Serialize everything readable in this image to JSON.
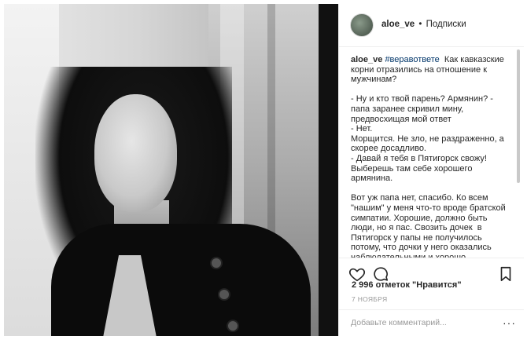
{
  "post": {
    "username": "aloe_ve",
    "separator": "•",
    "follow_label": "Подписки",
    "caption_user": "aloe_ve",
    "hashtag": "#веравответе",
    "caption_text": "  Как кавказские корни отразились на отношение к мужчинам?\n\n- Ну и кто твой парень? Армянин? - папа заранее скривил мину, предвосхищая мой ответ\n- Нет.\nМорщится. Не зло, не раздраженно, а скорее досадливо.\n- Давай я тебя в Пятигорск свожу! Выберешь там себе хорошего армянина.\n\nВот уж папа нет, спасибо. Ко всем \"нашим\" у меня что-то вроде братской симпатии. Хорошие, должно быть люди, но я пас. Свозить дочек  в Пятигорск у папы не получилось потому, что дочки у него оказались наблюдательными и хорошо рассмотрели все, что происходило в семье.",
    "likes_text": "2 996 отметок \"Нравится\"",
    "date_text": "7 НОЯБРЯ",
    "comment_placeholder": "Добавьте комментарий...",
    "more_label": "···"
  },
  "icons": {
    "like": "heart-icon",
    "comment": "comment-icon",
    "share": "share-icon",
    "save": "bookmark-icon"
  },
  "colors": {
    "text": "#262626",
    "hashtag": "#003569",
    "muted": "#999999",
    "border": "#efefef"
  }
}
